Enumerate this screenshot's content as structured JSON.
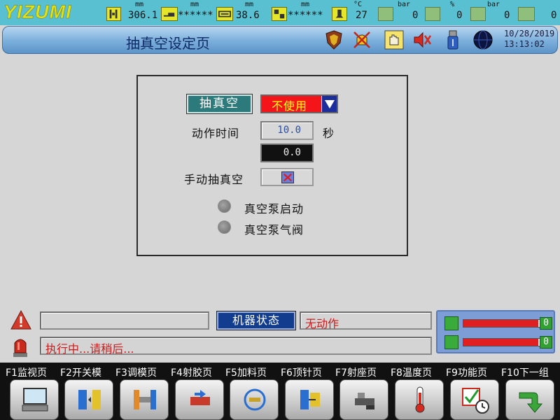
{
  "topbar": {
    "logo": "YIZUMI",
    "readouts": [
      {
        "unit": "mm",
        "value": "306.1"
      },
      {
        "unit": "mm",
        "value": "******"
      },
      {
        "unit": "mm",
        "value": "38.6"
      },
      {
        "unit": "mm",
        "value": "******"
      },
      {
        "unit": "°C",
        "value": "27"
      },
      {
        "unit": "bar",
        "value": "0"
      },
      {
        "unit": "%",
        "value": "0"
      },
      {
        "unit": "bar",
        "value": "0"
      },
      {
        "unit": "",
        "value": "0"
      }
    ]
  },
  "titlebar": {
    "title": "抽真空设定页",
    "date": "10/28/2019",
    "time": "13:13:02"
  },
  "panel": {
    "vacuum_label": "抽真空",
    "vacuum_select": "不使用",
    "action_time_label": "动作时间",
    "action_time_value": "10.0",
    "action_time_unit": "秒",
    "action_time_actual": "0.0",
    "manual_vacuum_label": "手动抽真空",
    "pump_start_label": "真空泵启动",
    "pump_valve_label": "真空泵气阀"
  },
  "status": {
    "alarm_text": "",
    "machine_status_label": "机器状态",
    "machine_status_value": "无动作",
    "message": "执行中...请稍后...",
    "gauge1_value": "0",
    "gauge2_value": "0",
    "gauge1_fraction": 0.97,
    "gauge2_fraction": 0.97
  },
  "fkeys": [
    {
      "label": "F1监视页",
      "icon": "monitor-icon"
    },
    {
      "label": "F2开关模",
      "icon": "mold-open-close-icon"
    },
    {
      "label": "F3调模页",
      "icon": "mold-adjust-icon"
    },
    {
      "label": "F4射胶页",
      "icon": "injection-icon"
    },
    {
      "label": "F5加料页",
      "icon": "charging-icon"
    },
    {
      "label": "F6顶针页",
      "icon": "ejector-icon"
    },
    {
      "label": "F7射座页",
      "icon": "carriage-icon"
    },
    {
      "label": "F8温度页",
      "icon": "thermometer-icon"
    },
    {
      "label": "F9功能页",
      "icon": "function-check-icon"
    },
    {
      "label": "F10下一组",
      "icon": "next-arrow-icon"
    }
  ],
  "colors": {
    "topbar": "#59c0d2",
    "title_bg": "#7aaedb",
    "vacuum_button": "#2c7a7c",
    "select_bg": "#f3151a",
    "select_text": "#ffff14",
    "machine_status_bg": "#123d8e",
    "alert_text": "#d01818"
  }
}
